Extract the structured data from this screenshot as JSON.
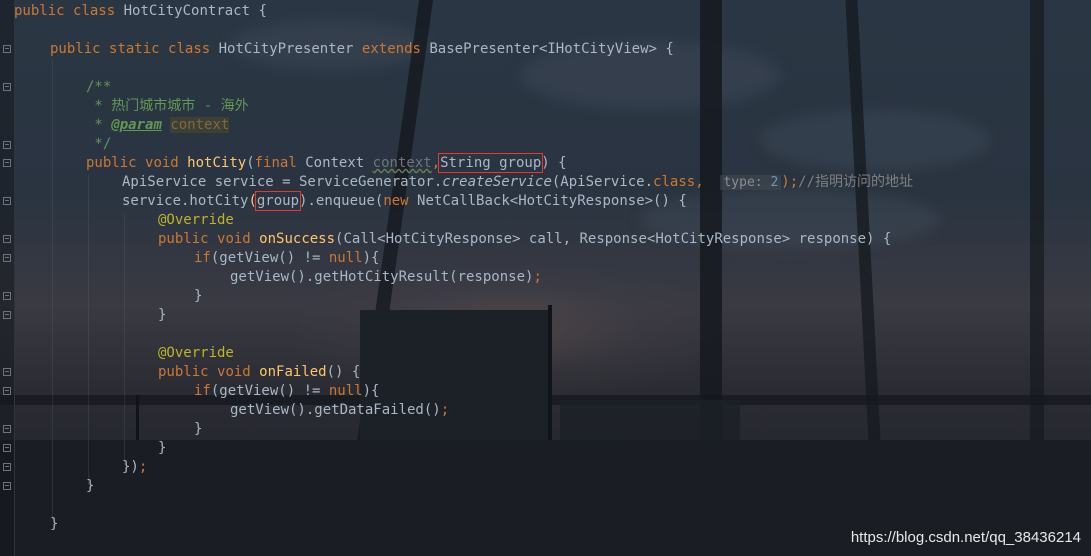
{
  "editor": {
    "theme_colors": {
      "keyword": "#cc7832",
      "function": "#ffc66d",
      "text": "#a9b7c6",
      "comment": "#629755",
      "annotation": "#bbb529",
      "number": "#6897bb",
      "highlight_box": "#e23b2e"
    },
    "lines": {
      "l1": {
        "kw1": "public",
        "kw2": "class",
        "name": "HotCityContract",
        "brace": "{"
      },
      "l2": {
        "kw1": "public",
        "kw2": "static",
        "kw3": "class",
        "name": "HotCityPresenter",
        "kw4": "extends",
        "parent": "BasePresenter<IHotCityView>",
        "brace": "{"
      },
      "l3": "/**",
      "l4": " * 热门城市城市 - 海外",
      "l5": {
        "star": " * ",
        "tag": "@param",
        "ref": "context"
      },
      "l6": " */",
      "l7": {
        "kw1": "public",
        "kw2": "void",
        "fn": "hotCity",
        "p1": "(",
        "kw3": "final",
        "type": "Context",
        "param": "context",
        "comma": ",",
        "boxed": "String group",
        "end": ") {"
      },
      "l8": {
        "a": "ApiService service = ServiceGenerator.",
        "call": "createService",
        "b": "(ApiService.",
        "kw": "class",
        "c": ",",
        "hint": "type:",
        "num": "2",
        "d": ");",
        "comment": "//指明访问的地址"
      },
      "l9": {
        "a": "service.hotCity",
        "p": "(",
        "boxed": "group",
        "b": ").enqueue(",
        "kw": "new",
        "c": " NetCallBack<HotCityResponse>() {"
      },
      "l10": "@Override",
      "l11": {
        "kw1": "public",
        "kw2": "void",
        "fn": "onSuccess",
        "rest": "(Call<HotCityResponse> call, Response<HotCityResponse> response) {"
      },
      "l12": {
        "kw": "if",
        "a": "(getView() != ",
        "null": "null",
        "b": "){"
      },
      "l13": {
        "a": "getView().getHotCityResult(response)",
        "semi": ";"
      },
      "l14": "}",
      "l15": "}",
      "l16": "@Override",
      "l17": {
        "kw1": "public",
        "kw2": "void",
        "fn": "onFailed",
        "rest": "() {"
      },
      "l18": {
        "kw": "if",
        "a": "(getView() != ",
        "null": "null",
        "b": "){"
      },
      "l19": {
        "a": "getView().getDataFailed()",
        "semi": ";"
      },
      "l20": "}",
      "l21": "}",
      "l22": {
        "a": "})",
        "semi": ";"
      },
      "l23": "}",
      "l24": "}"
    }
  },
  "watermark": "https://blog.csdn.net/qq_38436214"
}
